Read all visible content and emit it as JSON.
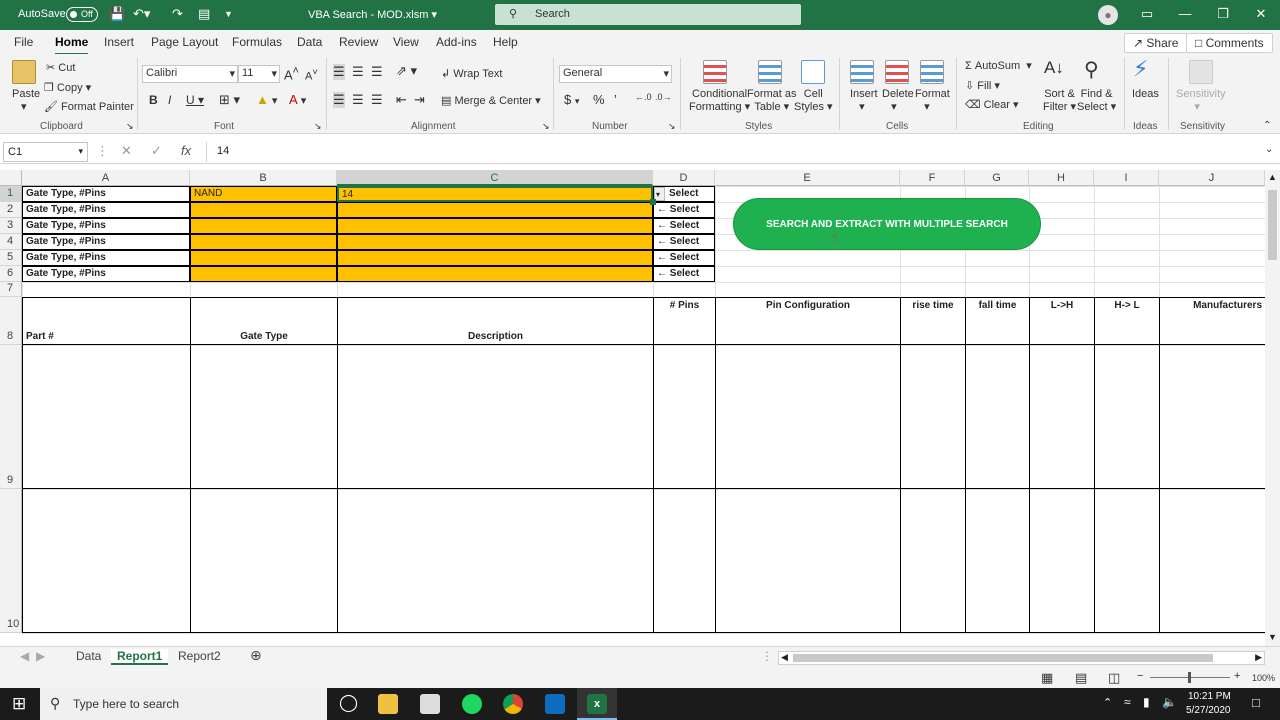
{
  "titlebar": {
    "autosave": "AutoSave",
    "autosave_state": "Off",
    "doc_title": "VBA Search - MOD.xlsm",
    "search_placeholder": "Search"
  },
  "menubar": {
    "file": "File",
    "home": "Home",
    "insert": "Insert",
    "page_layout": "Page Layout",
    "formulas": "Formulas",
    "data": "Data",
    "review": "Review",
    "view": "View",
    "addins": "Add-ins",
    "help": "Help",
    "share": "Share",
    "comments": "Comments"
  },
  "ribbon": {
    "clipboard": {
      "paste": "Paste",
      "cut": "Cut",
      "copy": "Copy",
      "format_painter": "Format Painter",
      "label": "Clipboard"
    },
    "font": {
      "name": "Calibri",
      "size": "11",
      "label": "Font"
    },
    "alignment": {
      "wrap_text": "Wrap Text",
      "merge_center": "Merge & Center",
      "label": "Alignment"
    },
    "number": {
      "format": "General",
      "label": "Number"
    },
    "styles": {
      "conditional": "Conditional",
      "formatting": "Formatting",
      "format_as": "Format as",
      "table": "Table",
      "cell": "Cell",
      "cell_styles": "Styles",
      "label": "Styles"
    },
    "cells": {
      "insert": "Insert",
      "delete": "Delete",
      "format": "Format",
      "label": "Cells"
    },
    "editing": {
      "autosum": "AutoSum",
      "fill": "Fill",
      "clear": "Clear",
      "sort": "Sort &",
      "filter": "Filter",
      "find": "Find &",
      "select": "Select",
      "label": "Editing"
    },
    "ideas": {
      "ideas": "Ideas",
      "label": "Ideas"
    },
    "sensitivity": {
      "sensitivity": "Sensitivity",
      "label": "Sensitivity"
    }
  },
  "formulabar": {
    "namebox": "C1",
    "value": "14"
  },
  "columns": [
    "A",
    "B",
    "C",
    "D",
    "E",
    "F",
    "G",
    "H",
    "I",
    "J"
  ],
  "rows": [
    "1",
    "2",
    "3",
    "4",
    "5",
    "6",
    "7",
    "8",
    "9",
    "10"
  ],
  "search_rows": [
    {
      "label": "Gate Type, #Pins",
      "b": "NAND",
      "c": "14",
      "d": "Select"
    },
    {
      "label": "Gate Type, #Pins",
      "b": "",
      "c": "",
      "d": "← Select"
    },
    {
      "label": "Gate Type, #Pins",
      "b": "",
      "c": "",
      "d": "← Select"
    },
    {
      "label": "Gate Type, #Pins",
      "b": "",
      "c": "",
      "d": "← Select"
    },
    {
      "label": "Gate Type, #Pins",
      "b": "",
      "c": "",
      "d": "← Select"
    },
    {
      "label": "Gate Type, #Pins",
      "b": "",
      "c": "",
      "d": "← Select"
    }
  ],
  "headers": {
    "a": "Part #",
    "b": "Gate Type",
    "c": "Description",
    "d": "#  Pins",
    "e": "Pin Configuration",
    "f": "rise time",
    "g": "fall time",
    "h": "L->H",
    "i": "H-> L",
    "j": "Manufacturers"
  },
  "macro_button": "SEARCH AND EXTRACT WITH MULTIPLE SEARCH",
  "sheets": [
    "Data",
    "Report1",
    "Report2"
  ],
  "status": {
    "zoom": "100%"
  },
  "taskbar": {
    "search_placeholder": "Type here to search",
    "time": "10:21 PM",
    "date": "5/27/2020"
  },
  "colors": {
    "excel_green": "#217346",
    "orange": "#ffc000",
    "button_green": "#1fb14f"
  }
}
